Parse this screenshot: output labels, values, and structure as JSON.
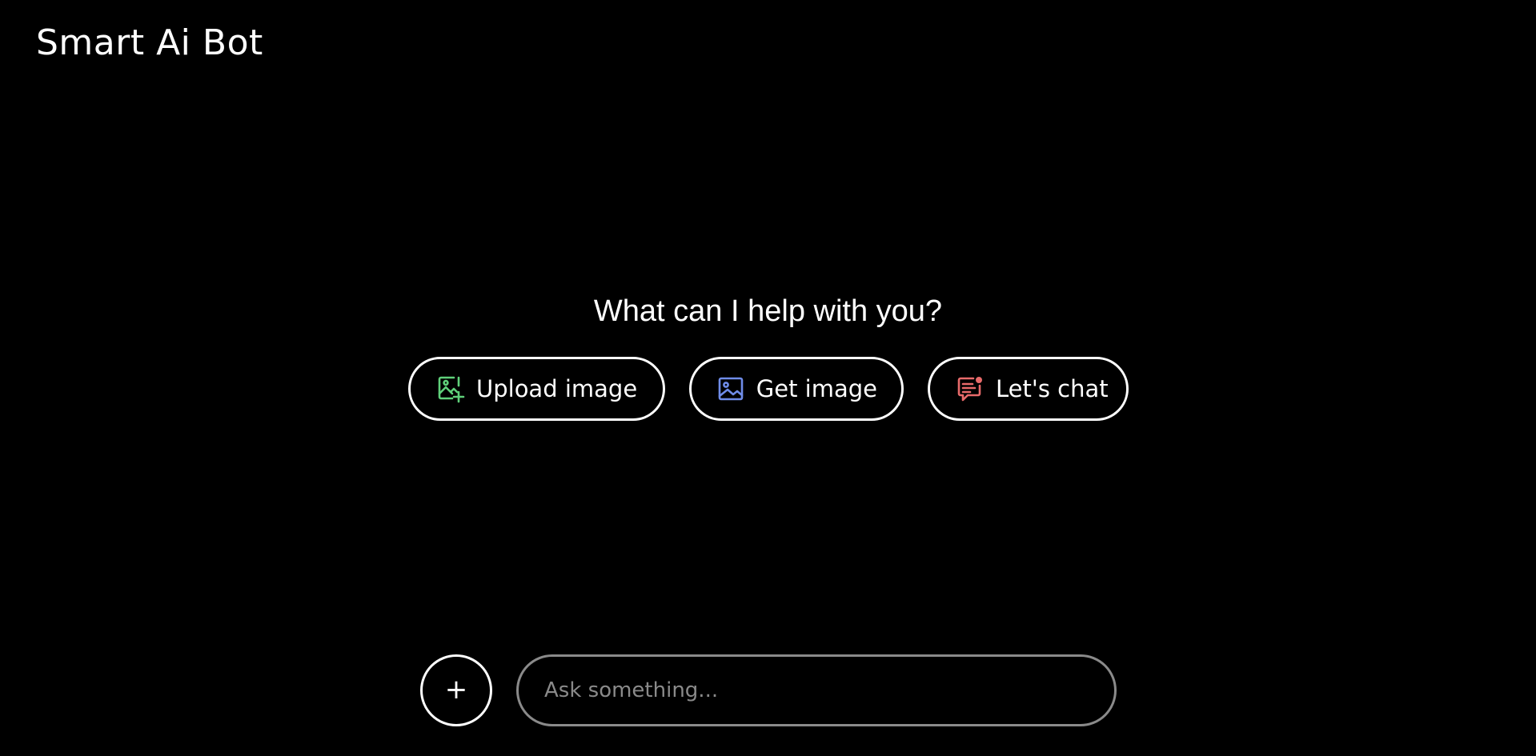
{
  "header": {
    "title": "Smart Ai Bot"
  },
  "hero": {
    "heading": "What can I help with you?"
  },
  "actions": [
    {
      "label": "Upload image",
      "icon": "image-add-icon",
      "color": "#5fd07a"
    },
    {
      "label": "Get image",
      "icon": "image-icon",
      "color": "#6f8ce8"
    },
    {
      "label": "Let's chat",
      "icon": "chat-notification-icon",
      "color": "#e86a6a"
    }
  ],
  "composer": {
    "plus_label": "+",
    "input_value": "",
    "input_placeholder": "Ask something..."
  },
  "colors": {
    "background": "#000000",
    "text": "#ffffff",
    "input_border": "#8a8a8a"
  }
}
